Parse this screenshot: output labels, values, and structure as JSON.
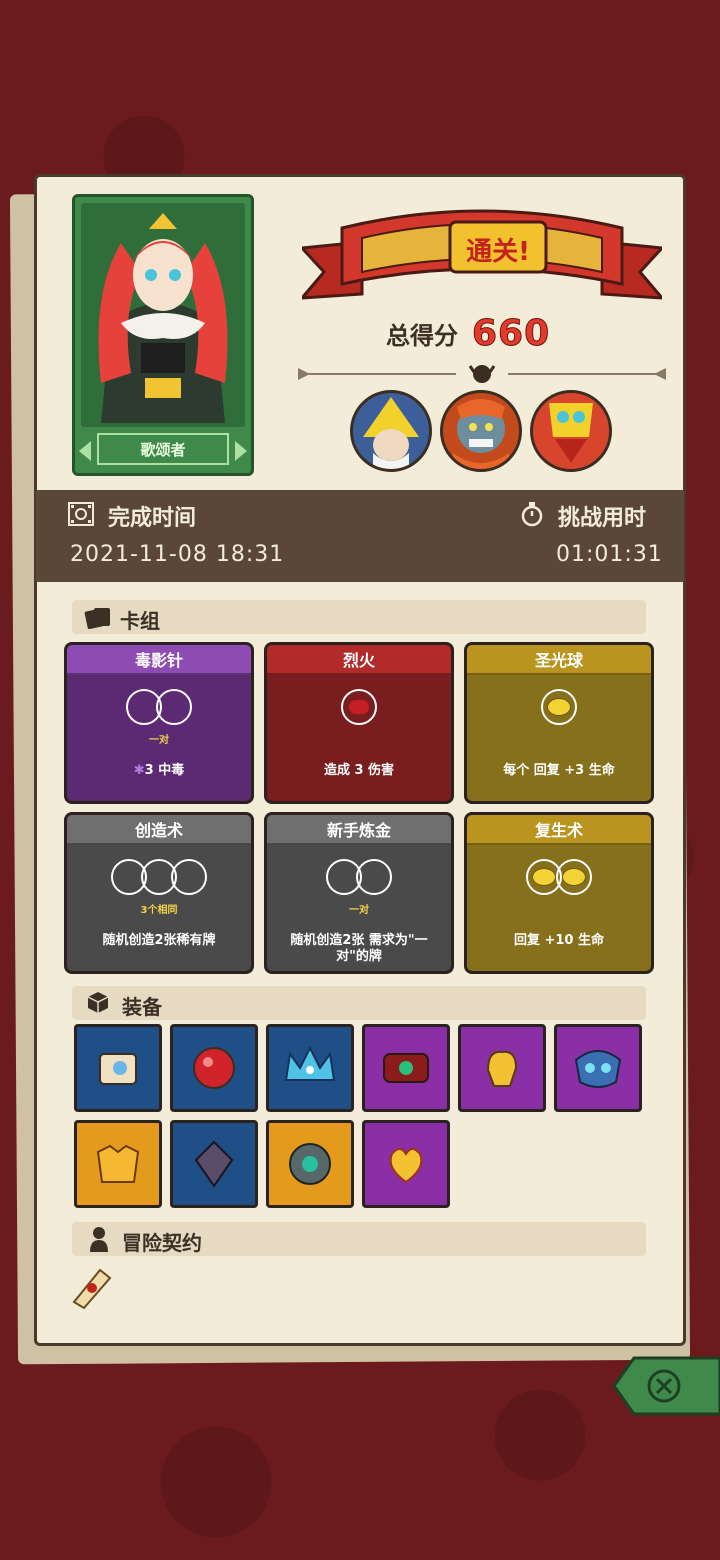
{
  "hero": {
    "name": "歌颂者"
  },
  "banner": {
    "title": "通关!"
  },
  "score": {
    "label": "总得分",
    "value": "660"
  },
  "times": {
    "finish_label": "完成时间",
    "finish_value": "2021-11-08 18:31",
    "duration_label": "挑战用时",
    "duration_value": "01:01:31"
  },
  "deck": {
    "title": "卡组",
    "cards": [
      {
        "name": "毒影针",
        "color": "purple",
        "requirement": "一对",
        "effect": "3 中毒"
      },
      {
        "name": "烈火",
        "color": "red",
        "requirement": "",
        "effect": "造成 3 伤害"
      },
      {
        "name": "圣光球",
        "color": "gold",
        "requirement": "",
        "effect": "每个  回复 +3 生命"
      },
      {
        "name": "创造术",
        "color": "gray",
        "requirement": "3个相同",
        "effect": "随机创造2张稀有牌"
      },
      {
        "name": "新手炼金",
        "color": "gray",
        "requirement": "一对",
        "effect": "随机创造2张 需求为\"一对\"的牌"
      },
      {
        "name": "复生术",
        "color": "gold",
        "requirement": "",
        "effect": "回复 +10 生命"
      }
    ]
  },
  "equipment": {
    "title": "装备",
    "items": [
      {
        "icon": "scroll-icon",
        "rarity": "blue"
      },
      {
        "icon": "ruby-gem-icon",
        "rarity": "blue"
      },
      {
        "icon": "ice-crown-icon",
        "rarity": "blue"
      },
      {
        "icon": "emerald-bracelet-icon",
        "rarity": "purple"
      },
      {
        "icon": "golden-glove-icon",
        "rarity": "purple"
      },
      {
        "icon": "spirit-mask-icon",
        "rarity": "purple"
      },
      {
        "icon": "golden-robe-icon",
        "rarity": "orange"
      },
      {
        "icon": "dark-crystal-icon",
        "rarity": "blue"
      },
      {
        "icon": "rune-stone-icon",
        "rarity": "orange"
      },
      {
        "icon": "fire-heart-icon",
        "rarity": "purple"
      }
    ]
  },
  "contract": {
    "title": "冒险契约",
    "icon": "contract-scroll-icon"
  },
  "colors": {
    "accent_red": "#e23a2c",
    "panel": "#f3ecd9",
    "time_bar": "#5b4738"
  }
}
